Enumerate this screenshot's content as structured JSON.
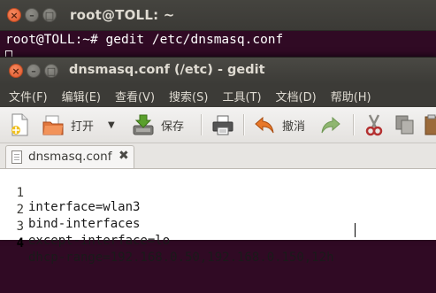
{
  "terminal": {
    "title": "root@TOLL: ~",
    "command_line": "root@TOLL:~# gedit /etc/dnsmasq.conf"
  },
  "gedit": {
    "title": "dnsmasq.conf (/etc) - gedit",
    "menu": [
      "文件(F)",
      "编辑(E)",
      "查看(V)",
      "搜索(S)",
      "工具(T)",
      "文档(D)",
      "帮助(H)"
    ],
    "toolbar": {
      "open_label": "打开",
      "save_label": "保存",
      "undo_label": "撤消"
    },
    "tab": {
      "label": "dnsmasq.conf"
    },
    "editor": {
      "lines": [
        {
          "num": "1",
          "text": "interface=wlan3"
        },
        {
          "num": "2",
          "text": "bind-interfaces"
        },
        {
          "num": "3",
          "text": "except-interface=lo"
        },
        {
          "num": "4",
          "text": "dhcp-range=192.168.0.50,192.168.0.150,12h"
        }
      ]
    }
  }
}
